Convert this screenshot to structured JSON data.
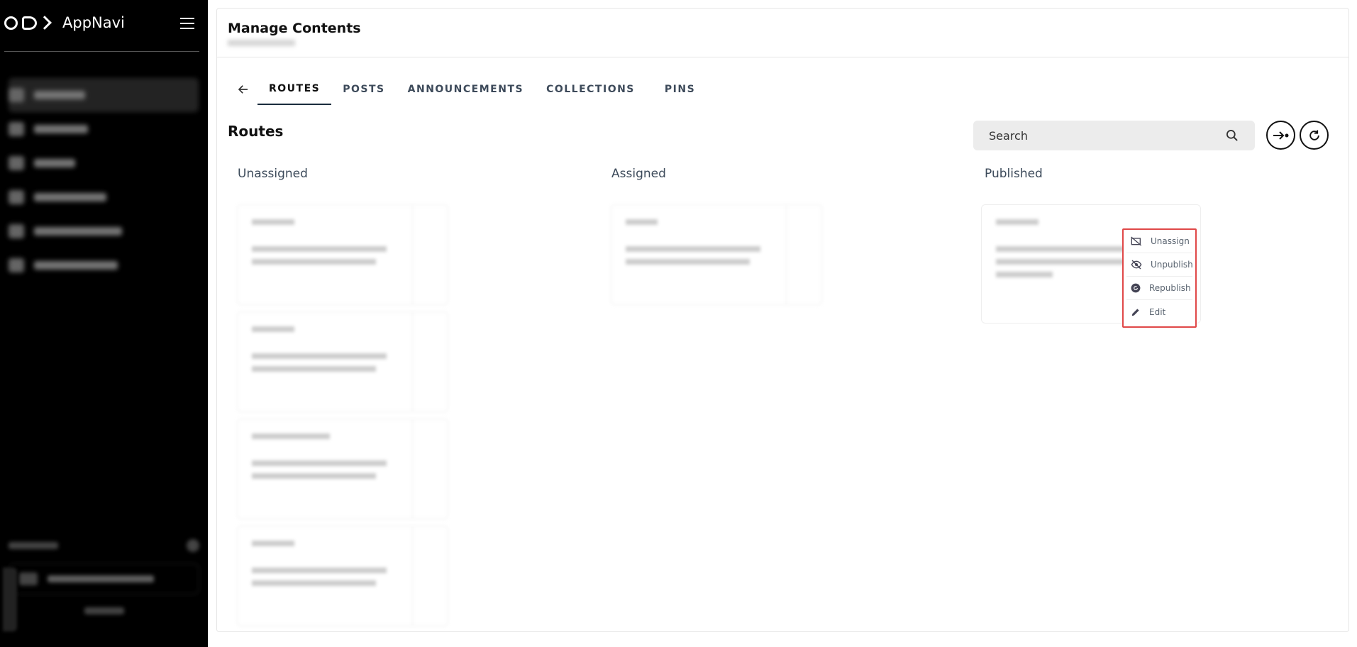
{
  "app": {
    "name": "AppNavi"
  },
  "page": {
    "title": "Manage Contents"
  },
  "tabs": [
    {
      "label": "ROUTES"
    },
    {
      "label": "POSTS"
    },
    {
      "label": "ANNOUNCEMENTS"
    },
    {
      "label": "COLLECTIONS"
    },
    {
      "label": "PINS"
    }
  ],
  "section": {
    "title": "Routes"
  },
  "search": {
    "placeholder": "Search"
  },
  "columns": {
    "unassigned": "Unassigned",
    "assigned": "Assigned",
    "published": "Published"
  },
  "context_menu": {
    "items": [
      {
        "label": "Unassign",
        "icon": "unassign-icon"
      },
      {
        "label": "Unpublish",
        "icon": "eye-off-icon"
      },
      {
        "label": "Republish",
        "icon": "republish-icon"
      },
      {
        "label": "Edit",
        "icon": "pencil-icon"
      }
    ]
  },
  "colors": {
    "sidebar": "#000000",
    "menu_border": "#e04848",
    "tab_text": "#3d4a5a"
  }
}
